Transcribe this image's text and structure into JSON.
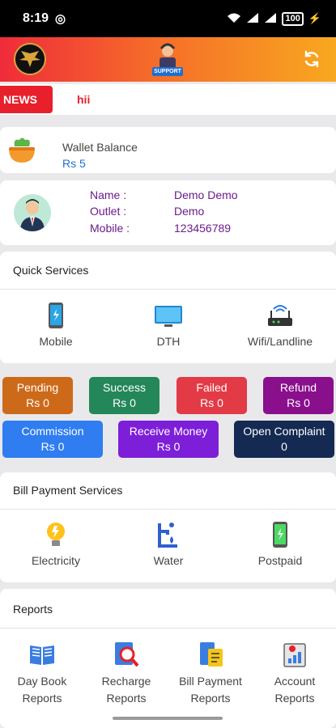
{
  "status_bar": {
    "time": "8:19",
    "battery": "100"
  },
  "header": {
    "support_label": "SUPPORT"
  },
  "news": {
    "tag": "NEWS",
    "text": "hii"
  },
  "wallet": {
    "label": "Wallet Balance",
    "value": "Rs 5"
  },
  "profile": {
    "name_label": "Name :",
    "name_value": "Demo Demo",
    "outlet_label": "Outlet :",
    "outlet_value": "Demo",
    "mobile_label": "Mobile :",
    "mobile_value": "123456789"
  },
  "quick_services": {
    "title": "Quick Services",
    "items": [
      {
        "label": "Mobile",
        "icon": "mobile-phone-icon"
      },
      {
        "label": "DTH",
        "icon": "tv-icon"
      },
      {
        "label": "Wifi/Landline",
        "icon": "router-icon"
      }
    ]
  },
  "status_buttons": [
    {
      "label": "Pending",
      "value": "Rs 0",
      "color": "#cc6a1a"
    },
    {
      "label": "Success",
      "value": "Rs 0",
      "color": "#24875a"
    },
    {
      "label": "Failed",
      "value": "Rs 0",
      "color": "#e23b46"
    },
    {
      "label": "Refund",
      "value": "Rs 0",
      "color": "#8a0f8c"
    },
    {
      "label": "Commission",
      "value": "Rs 0",
      "color": "#2f7df0"
    },
    {
      "label": "Receive Money",
      "value": "Rs 0",
      "color": "#7d1fd8"
    },
    {
      "label": "Open Complaint",
      "value": "0",
      "color": "#142a52"
    }
  ],
  "bill_payment": {
    "title": "Bill Payment Services",
    "items": [
      {
        "label": "Electricity",
        "icon": "bulb-icon"
      },
      {
        "label": "Water",
        "icon": "water-tap-icon"
      },
      {
        "label": "Postpaid",
        "icon": "mobile-phone-icon"
      }
    ]
  },
  "reports": {
    "title": "Reports",
    "items": [
      {
        "line1": "Day Book",
        "line2": "Reports",
        "icon": "book-icon"
      },
      {
        "line1": "Recharge",
        "line2": "Reports",
        "icon": "magnify-icon"
      },
      {
        "line1": "Bill Payment",
        "line2": "Reports",
        "icon": "bill-icon"
      },
      {
        "line1": "Account",
        "line2": "Reports",
        "icon": "account-report-icon"
      }
    ]
  }
}
